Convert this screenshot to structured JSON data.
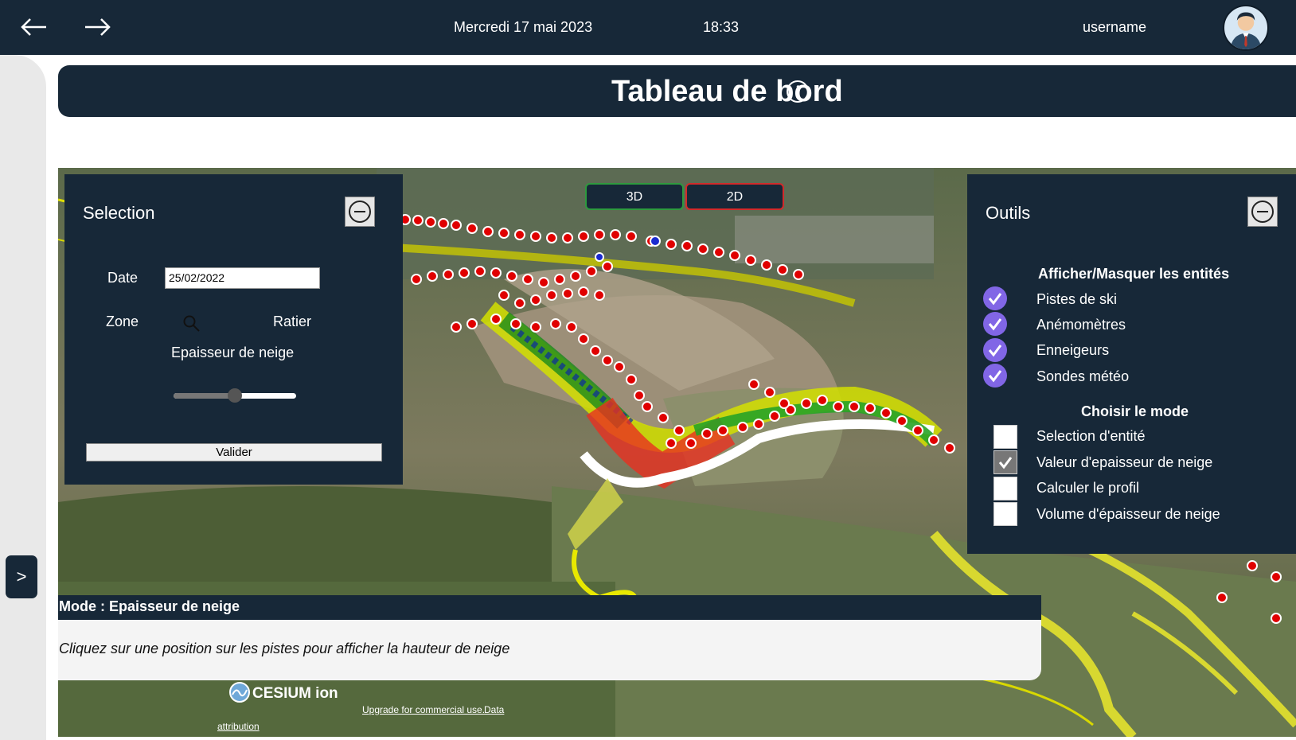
{
  "header": {
    "back_icon": "arrow-left-icon",
    "forward_icon": "arrow-right-icon",
    "date": "Mercredi 17 mai 2023",
    "time": "18:33",
    "username": "username",
    "avatar_icon": "user-avatar-icon"
  },
  "page": {
    "title": "Tableau de bord",
    "info_icon": "info-icon",
    "sidebar_toggle": ">"
  },
  "map": {
    "btn_3d": "3D",
    "btn_2d": "2D",
    "credit_brand": "CESIUM ion",
    "credit_upgrade": "Upgrade for commercial use.",
    "credit_data": "Data",
    "credit_attribution": "attribution"
  },
  "selection": {
    "title": "Selection",
    "date_label": "Date",
    "date_value": "25/02/2022",
    "zone_label": "Zone",
    "zone_value": "Ratier",
    "search_icon": "search-icon",
    "slider_label": "Epaisseur de neige",
    "slider_level": 0.5,
    "validate_label": "Valider"
  },
  "tools": {
    "title": "Outils",
    "entities_heading": "Afficher/Masquer les entités",
    "entities": [
      {
        "label": "Pistes de ski",
        "checked": true
      },
      {
        "label": "Anémomètres",
        "checked": true
      },
      {
        "label": "Enneigeurs",
        "checked": true
      },
      {
        "label": "Sondes météo",
        "checked": true
      }
    ],
    "mode_heading": "Choisir le mode",
    "modes": [
      {
        "label": "Selection d'entité",
        "checked": false
      },
      {
        "label": "Valeur d'epaisseur de neige",
        "checked": true
      },
      {
        "label": "Calculer le profil",
        "checked": false
      },
      {
        "label": "Volume d'épaisseur de neige",
        "checked": false
      }
    ]
  },
  "status": {
    "mode_title": "Mode : Epaisseur de neige",
    "message": "Cliquez sur une position sur les pistes pour afficher la hauteur de neige"
  },
  "colors": {
    "navy": "#172838",
    "check_purple": "#8166e6",
    "btn_3d_border": "#2e9a3e",
    "btn_2d_border": "#d22a2a"
  }
}
